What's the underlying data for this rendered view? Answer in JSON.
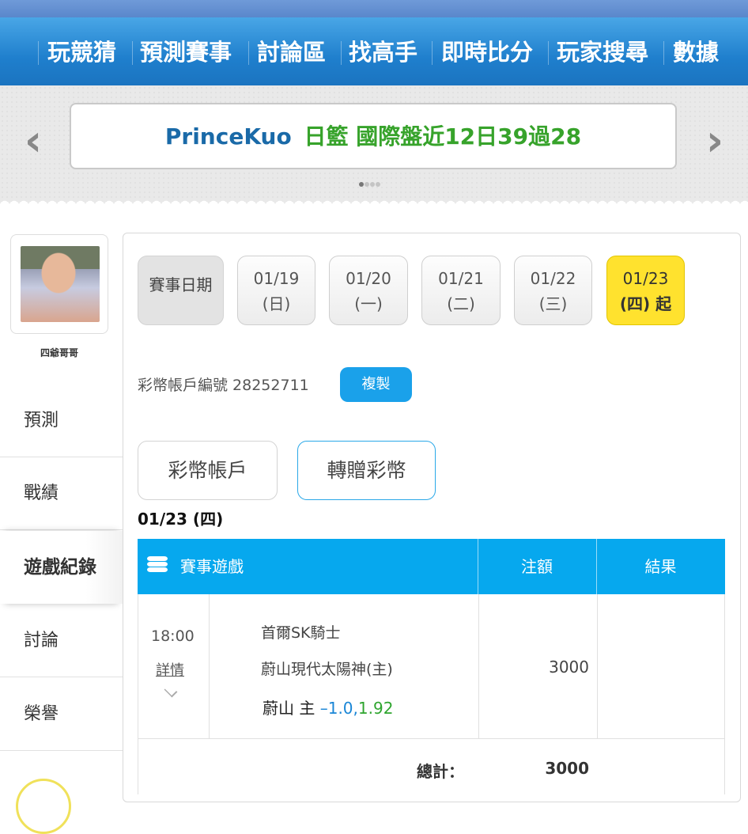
{
  "nav": {
    "items": [
      "玩競猜",
      "預測賽事",
      "討論區",
      "找高手",
      "即時比分",
      "玩家搜尋",
      "數據"
    ]
  },
  "banner": {
    "prev_icon": "chevron-left-icon",
    "next_icon": "chevron-right-icon",
    "name": "PrinceKuo",
    "note": "日籃 國際盤近12日39過28",
    "page_dots": 4,
    "active_dot": 0
  },
  "profile": {
    "username": "四爺哥哥"
  },
  "sidebar": {
    "items": [
      {
        "label": "預測",
        "active": false
      },
      {
        "label": "戰績",
        "active": false
      },
      {
        "label": "遊戲紀錄",
        "active": true
      },
      {
        "label": "討論",
        "active": false
      },
      {
        "label": "榮譽",
        "active": false
      }
    ]
  },
  "dates": {
    "label": "賽事日期",
    "items": [
      {
        "date": "01/19",
        "weekday": "(日)",
        "active": false
      },
      {
        "date": "01/20",
        "weekday": "(一)",
        "active": false
      },
      {
        "date": "01/21",
        "weekday": "(二)",
        "active": false
      },
      {
        "date": "01/22",
        "weekday": "(三)",
        "active": false
      },
      {
        "date": "01/23",
        "weekday": "(四) 起",
        "active": true
      }
    ]
  },
  "account": {
    "label": "彩幣帳戶編號 28252711",
    "copy_label": "複製"
  },
  "tabs": {
    "account": "彩幣帳戶",
    "transfer": "轉贈彩幣"
  },
  "day_label": "01/23 (四)",
  "table": {
    "icon": "coin-stack-icon",
    "headers": {
      "game": "賽事遊戲",
      "bet": "注額",
      "result": "結果"
    },
    "rows": [
      {
        "time": "18:00",
        "detail_link": "詳情",
        "away": "首爾SK騎士",
        "home": "蔚山現代太陽神(主)",
        "pick_team": "蔚山 主",
        "pick_line": "–1.0,",
        "pick_odds": "1.92",
        "amount": "3000",
        "result": ""
      }
    ],
    "total_label": "總計：",
    "total_value": "3000"
  },
  "colors": {
    "nav_bg": "#1f7fcd",
    "accent_blue": "#06a8ee",
    "active_date": "#ffe22e",
    "banner_name": "#1a6aa8",
    "banner_note": "#37a32b"
  }
}
